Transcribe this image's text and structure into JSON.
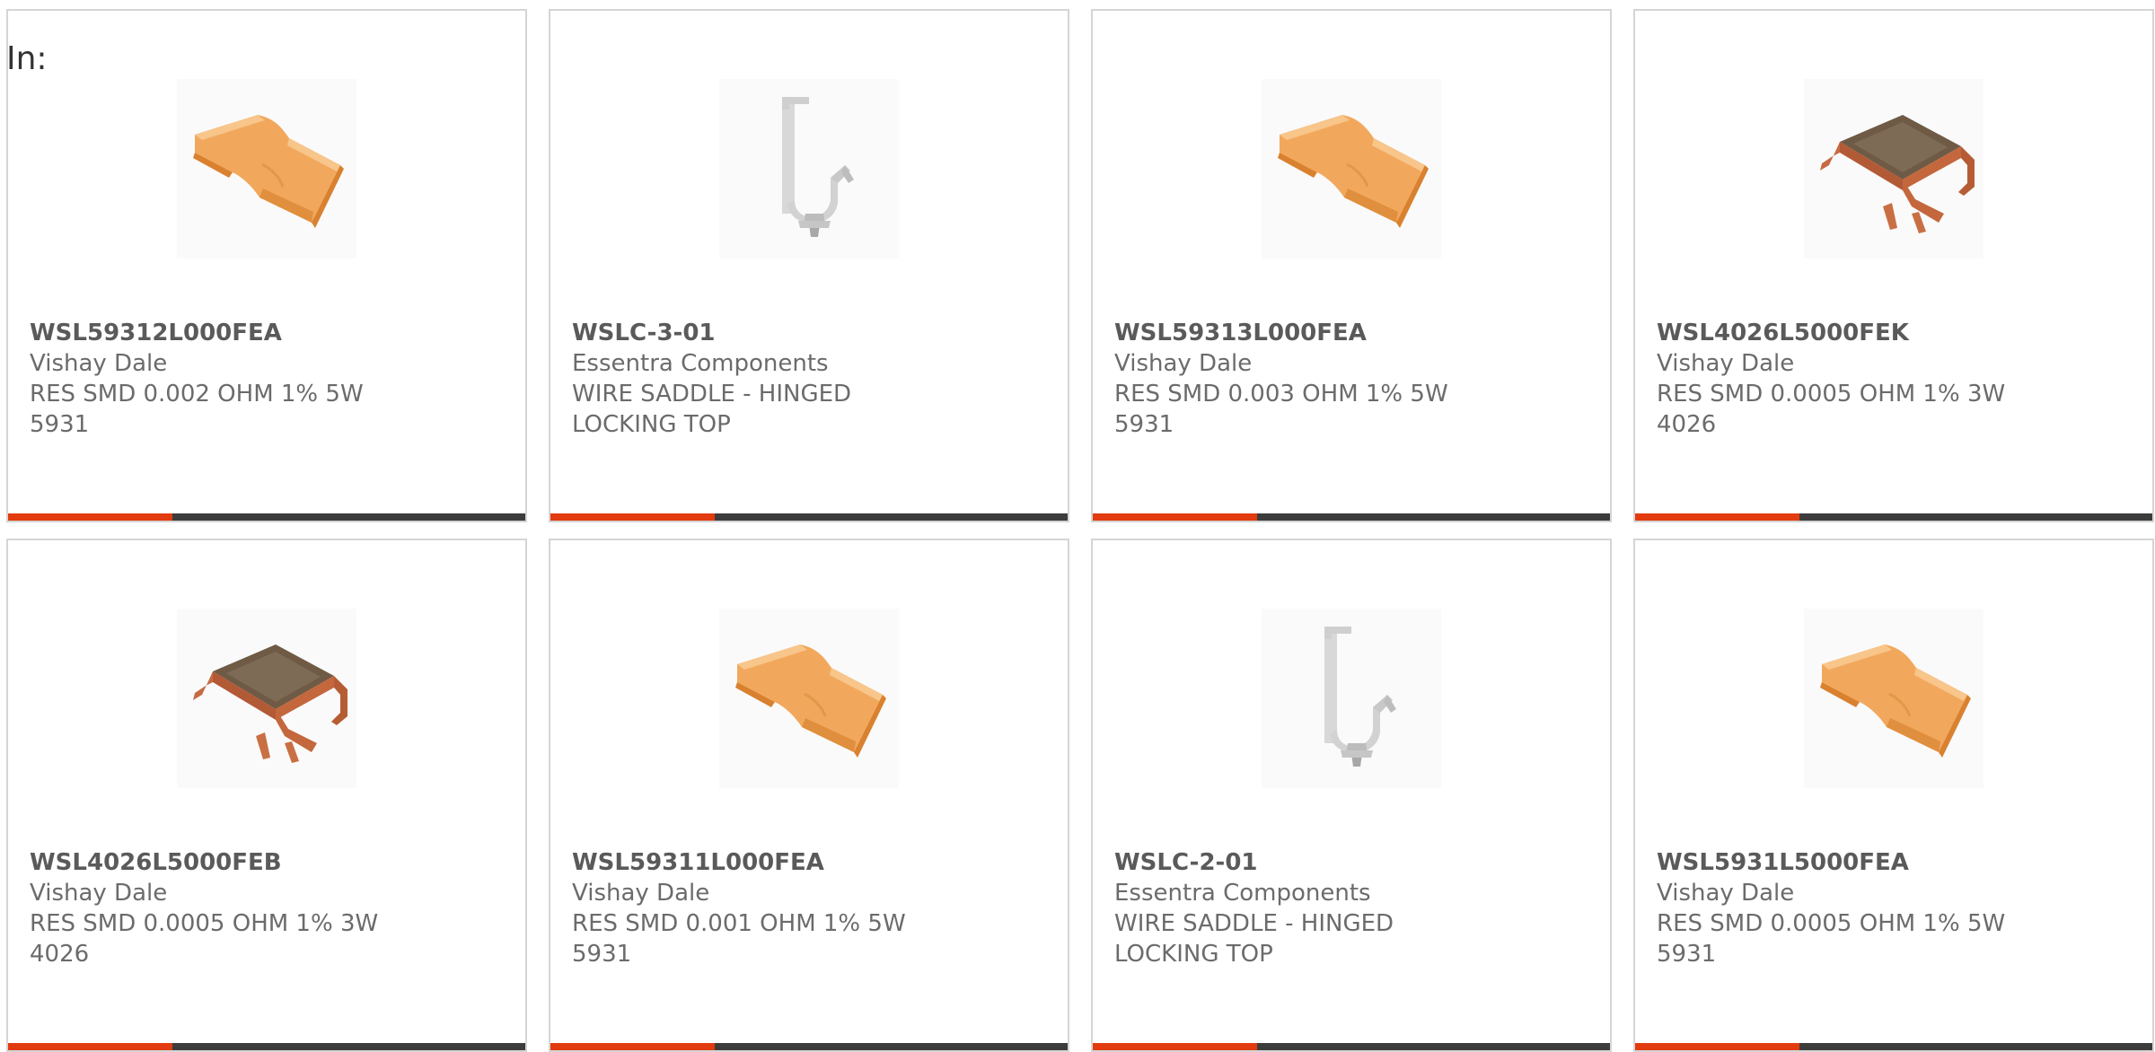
{
  "filter_label": "In:",
  "colors": {
    "accent": "#e23b0f",
    "bar": "#3c3c3c",
    "border": "#d5d5d5",
    "text": "#6b6b6b"
  },
  "products": [
    {
      "part_number": "WSL59312L000FEA",
      "manufacturer": "Vishay Dale",
      "description": "RES SMD 0.002 OHM 1% 5W 5931",
      "image_icon": "flat-resistor-icon"
    },
    {
      "part_number": "WSLC-3-01",
      "manufacturer": "Essentra Components",
      "description": "WIRE SADDLE - HINGED LOCKING TOP",
      "image_icon": "wire-saddle-icon"
    },
    {
      "part_number": "WSL59313L000FEA",
      "manufacturer": "Vishay Dale",
      "description": "RES SMD 0.003 OHM 1% 5W 5931",
      "image_icon": "flat-resistor-icon"
    },
    {
      "part_number": "WSL4026L5000FEK",
      "manufacturer": "Vishay Dale",
      "description": "RES SMD 0.0005 OHM 1% 3W 4026",
      "image_icon": "metal-strip-resistor-icon"
    },
    {
      "part_number": "WSL4026L5000FEB",
      "manufacturer": "Vishay Dale",
      "description": "RES SMD 0.0005 OHM 1% 3W 4026",
      "image_icon": "metal-strip-resistor-icon"
    },
    {
      "part_number": "WSL59311L000FEA",
      "manufacturer": "Vishay Dale",
      "description": "RES SMD 0.001 OHM 1% 5W 5931",
      "image_icon": "flat-resistor-icon"
    },
    {
      "part_number": "WSLC-2-01",
      "manufacturer": "Essentra Components",
      "description": "WIRE SADDLE - HINGED LOCKING TOP",
      "image_icon": "wire-saddle-icon"
    },
    {
      "part_number": "WSL5931L5000FEA",
      "manufacturer": "Vishay Dale",
      "description": "RES SMD 0.0005 OHM 1% 5W 5931",
      "image_icon": "flat-resistor-icon"
    }
  ]
}
